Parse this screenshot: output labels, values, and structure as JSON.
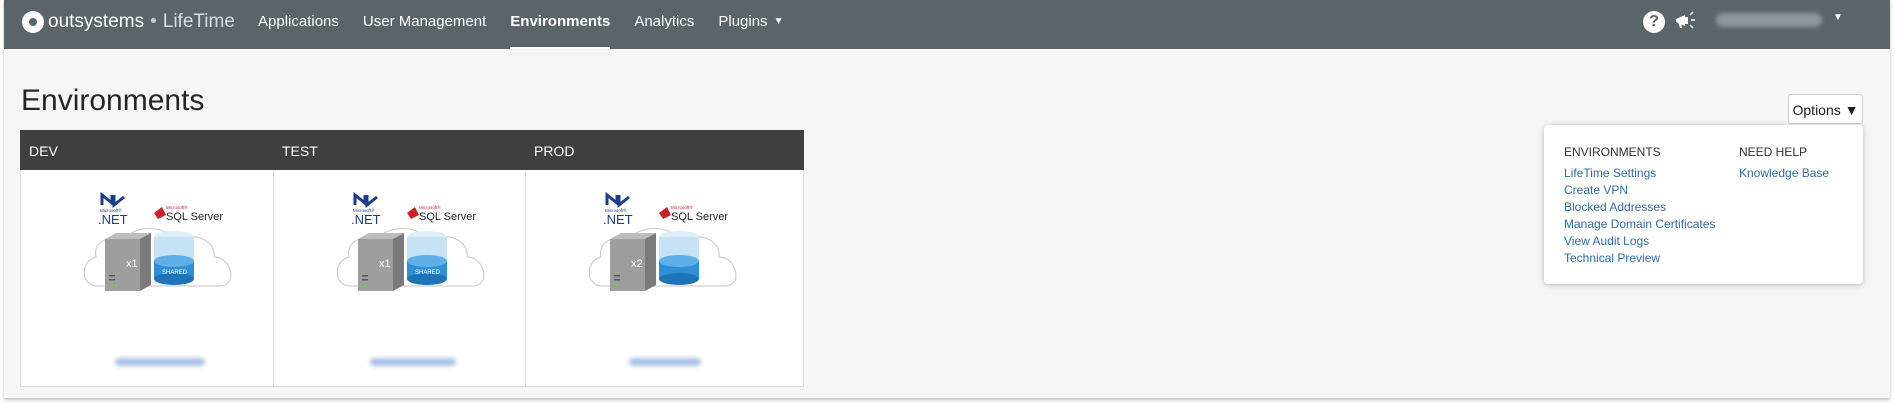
{
  "brand": {
    "name": "outsystems",
    "sep": "•",
    "product": "LifeTime"
  },
  "nav": {
    "items": [
      {
        "label": "Applications",
        "active": false
      },
      {
        "label": "User Management",
        "active": false
      },
      {
        "label": "Environments",
        "active": true
      },
      {
        "label": "Analytics",
        "active": false
      },
      {
        "label": "Plugins",
        "active": false,
        "dropdown": true
      }
    ]
  },
  "header_icons": {
    "help": "?",
    "notifications": "megaphone-icon"
  },
  "page": {
    "title": "Environments"
  },
  "options": {
    "button_label": "Options ▼",
    "environments_heading": "ENVIRONMENTS",
    "environments_links": [
      "LifeTime Settings",
      "Create VPN",
      "Blocked Addresses",
      "Manage Domain Certificates",
      "View Audit Logs",
      "Technical Preview"
    ],
    "help_heading": "NEED HELP",
    "help_links": [
      "Knowledge Base"
    ]
  },
  "environments": [
    {
      "name": "DEV",
      "servers": "x1",
      "db_label": "SHARED",
      "net_small": "Microsoft®",
      "net": ".NET",
      "sql_small": "Microsoft®",
      "sql": "SQL Server"
    },
    {
      "name": "TEST",
      "servers": "x1",
      "db_label": "SHARED",
      "net_small": "Microsoft®",
      "net": ".NET",
      "sql_small": "Microsoft®",
      "sql": "SQL Server"
    },
    {
      "name": "PROD",
      "servers": "x2",
      "db_label": "",
      "net_small": "Microsoft®",
      "net": ".NET",
      "sql_small": "Microsoft®",
      "sql": "SQL Server"
    }
  ],
  "colors": {
    "topbar": "#5a6469",
    "card_header": "#3d4043",
    "link": "#2f6aa9",
    "db_blue": "#2e8fd6",
    "net_blue": "#1a3e8c",
    "sql_red": "#cc2027"
  }
}
